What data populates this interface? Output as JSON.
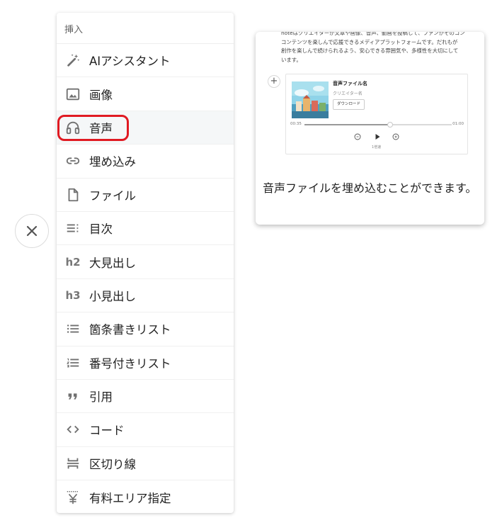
{
  "menu": {
    "header": "挿入",
    "items": [
      {
        "label": "AIアシスタント",
        "icon": "magic-wand-icon"
      },
      {
        "label": "画像",
        "icon": "image-icon"
      },
      {
        "label": "音声",
        "icon": "headphones-icon"
      },
      {
        "label": "埋め込み",
        "icon": "link-icon"
      },
      {
        "label": "ファイル",
        "icon": "file-icon"
      },
      {
        "label": "目次",
        "icon": "table-of-contents-icon"
      },
      {
        "label": "大見出し",
        "icon": "h2-icon",
        "icon_text": "h2"
      },
      {
        "label": "小見出し",
        "icon": "h3-icon",
        "icon_text": "h3"
      },
      {
        "label": "箇条書きリスト",
        "icon": "bulleted-list-icon"
      },
      {
        "label": "番号付きリスト",
        "icon": "numbered-list-icon"
      },
      {
        "label": "引用",
        "icon": "quote-icon"
      },
      {
        "label": "コード",
        "icon": "code-icon"
      },
      {
        "label": "区切り線",
        "icon": "divider-icon"
      },
      {
        "label": "有料エリア指定",
        "icon": "yen-paywall-icon"
      }
    ],
    "highlighted_item": "音声",
    "highlight_color": "#e01a22"
  },
  "close_button": {
    "icon": "close-icon"
  },
  "tooltip": {
    "preview": {
      "text_line1": "noteはクリエイターが文章や画像、音声、動画を投稿して、ファンがそのコン",
      "text_line2": "コンテンツを楽しんで応援できるメディアプラットフォームです。だれもが",
      "text_line3": "創作を楽しんで続けられるよう、安心できる雰囲気や、多様性を大切にして",
      "text_line4": "います。",
      "player": {
        "title": "音声ファイル名",
        "creator": "クリエイター名",
        "download_label": "ダウンロード",
        "time_current": "00:35",
        "time_total": "01:00",
        "progress": 0.58,
        "speed": "1倍速"
      }
    },
    "description": "音声ファイルを埋め込むことができます。"
  }
}
